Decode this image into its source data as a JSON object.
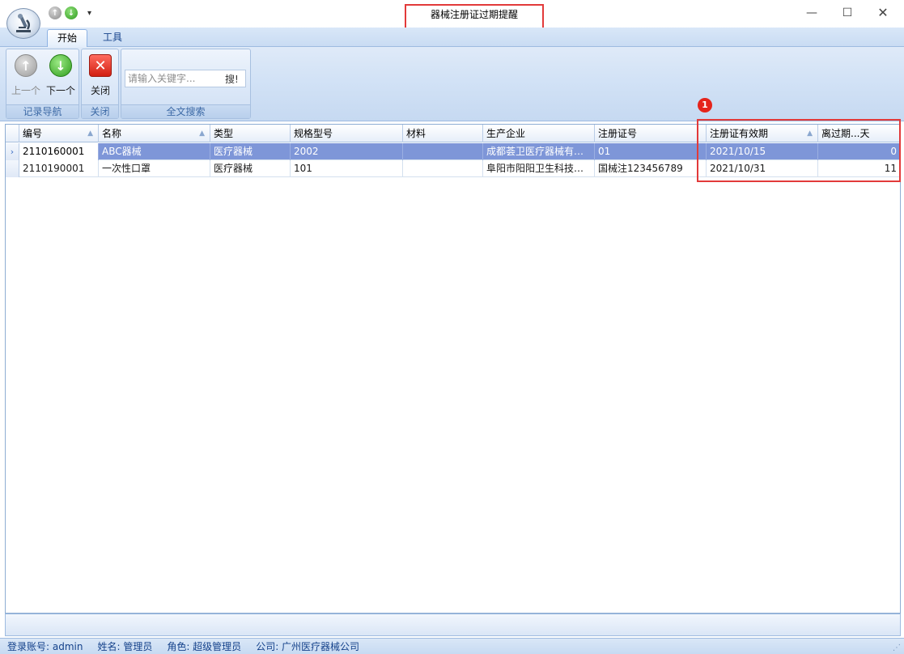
{
  "window": {
    "title": "器械注册证过期提醒",
    "min_icon": "minimize-icon",
    "max_icon": "maximize-icon",
    "close_icon": "close-icon"
  },
  "quick_access": {
    "up_icon": "arrow-up-icon",
    "down_icon": "arrow-down-icon",
    "more": "▾"
  },
  "ribbon": {
    "tabs": [
      {
        "label": "开始"
      },
      {
        "label": "工具"
      }
    ],
    "groups": {
      "nav": {
        "caption": "记录导航",
        "prev_label": "上一个",
        "next_label": "下一个"
      },
      "close": {
        "caption": "关闭",
        "close_label": "关闭"
      },
      "search": {
        "caption": "全文搜索",
        "placeholder": "请输入关键字...",
        "button": "搜!"
      }
    }
  },
  "grid": {
    "columns": [
      {
        "label": "编号",
        "sorted": true
      },
      {
        "label": "名称",
        "sorted": true
      },
      {
        "label": "类型"
      },
      {
        "label": "规格型号"
      },
      {
        "label": "材料"
      },
      {
        "label": "生产企业"
      },
      {
        "label": "注册证号"
      },
      {
        "label": "注册证有效期",
        "sorted": true
      },
      {
        "label": "离过期...天"
      }
    ],
    "rows": [
      {
        "selected": true,
        "cells": [
          "2110160001",
          "ABC器械",
          "医疗器械",
          "2002",
          "",
          "成都荟卫医疗器械有限...",
          "01",
          "2021/10/15",
          "0"
        ]
      },
      {
        "selected": false,
        "cells": [
          "2110190001",
          "一次性口罩",
          "医疗器械",
          "101",
          "",
          "阜阳市阳阳卫生科技有...",
          "国械注123456789",
          "2021/10/31",
          "11"
        ]
      }
    ]
  },
  "annotation": {
    "badge": "1"
  },
  "status": {
    "account": "登录账号: admin",
    "name": "姓名: 管理员",
    "role": "角色: 超级管理员",
    "company": "公司: 广州医疗器械公司"
  },
  "colors": {
    "selected_row": "#7e96d8",
    "highlight": "#e23a3a",
    "ribbon": "#d2e2f6"
  }
}
